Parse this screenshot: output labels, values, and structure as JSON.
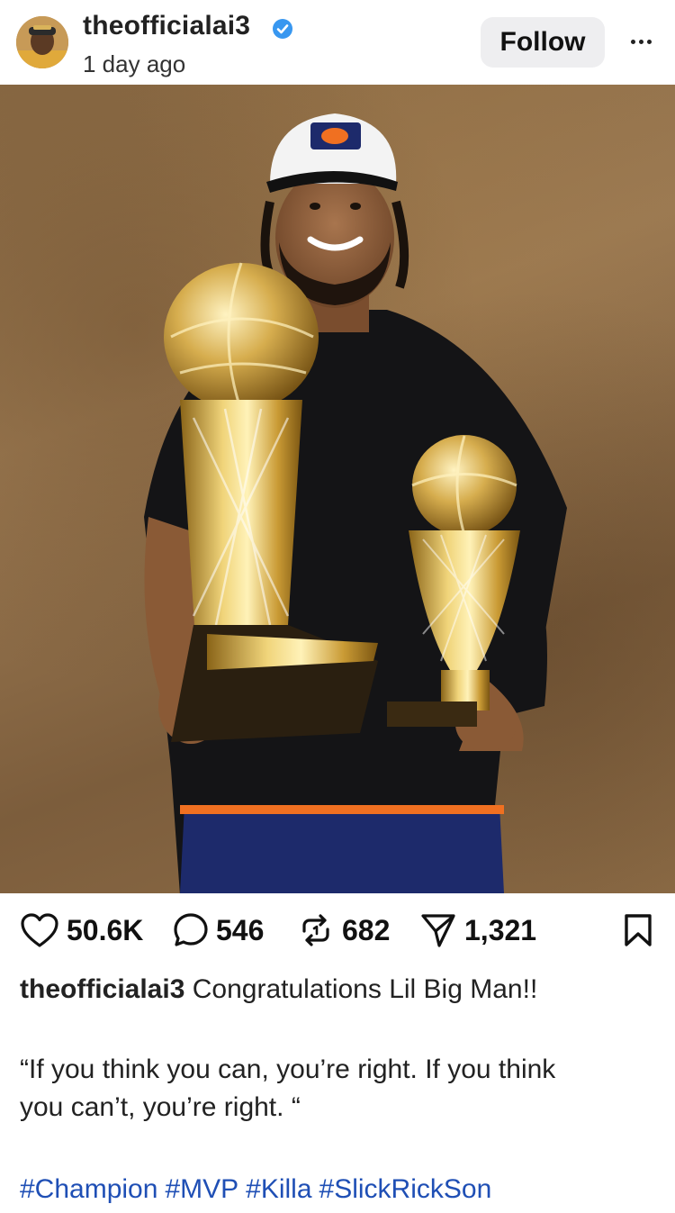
{
  "post": {
    "username": "theofficialai3",
    "verified": true,
    "time": "1 day ago",
    "follow_label": "Follow",
    "more_label": "···"
  },
  "photo": {
    "subject": "player-with-trophies",
    "background_color": "#8a6a44"
  },
  "actions": {
    "likes": "50.6K",
    "comments": "546",
    "reposts": "682",
    "shares": "1,321",
    "like_icon": "heart-icon",
    "comment_icon": "comment-icon",
    "repost_icon": "repost-icon",
    "share_icon": "share-icon",
    "save_icon": "bookmark-icon"
  },
  "caption": {
    "username": "theofficialai3",
    "text": "Congratulations Lil Big Man!!",
    "quote_line1": "“If you think you can, you’re right. If you think",
    "quote_line2": "you can’t, you’re right. “",
    "hashtags": [
      "#Champion",
      "#MVP",
      "#Killa",
      "#SlickRickSon"
    ]
  },
  "colors": {
    "accent": "#1f4fb5",
    "verified": "#3897f0",
    "follow_bg": "#eeeef0"
  }
}
